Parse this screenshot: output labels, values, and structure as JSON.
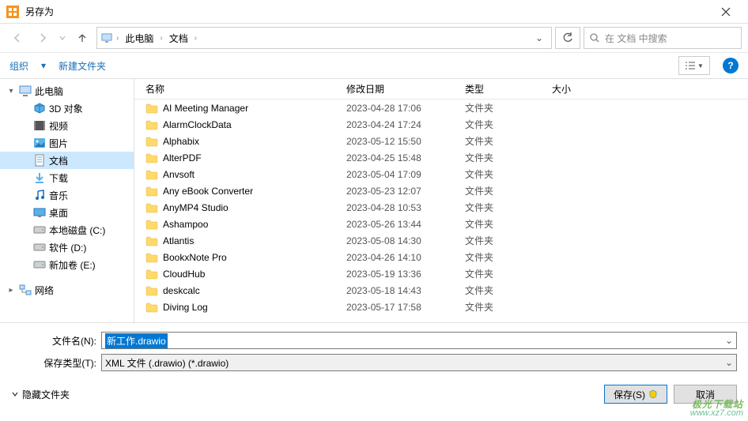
{
  "window": {
    "title": "另存为"
  },
  "breadcrumb": {
    "root": "此电脑",
    "folder": "文档"
  },
  "search": {
    "placeholder": "在 文档 中搜索"
  },
  "toolbar": {
    "organize": "组织",
    "newfolder": "新建文件夹"
  },
  "sidebar": [
    {
      "label": "此电脑",
      "icon": "pc",
      "exp": "▾",
      "level": 0
    },
    {
      "label": "3D 对象",
      "icon": "3d",
      "level": 1
    },
    {
      "label": "视频",
      "icon": "video",
      "level": 1
    },
    {
      "label": "图片",
      "icon": "pic",
      "level": 1
    },
    {
      "label": "文档",
      "icon": "doc",
      "level": 1,
      "selected": true
    },
    {
      "label": "下载",
      "icon": "dl",
      "level": 1
    },
    {
      "label": "音乐",
      "icon": "music",
      "level": 1
    },
    {
      "label": "桌面",
      "icon": "desk",
      "level": 1
    },
    {
      "label": "本地磁盘 (C:)",
      "icon": "disk",
      "level": 1
    },
    {
      "label": "软件 (D:)",
      "icon": "disk",
      "level": 1
    },
    {
      "label": "新加卷 (E:)",
      "icon": "disk",
      "level": 1
    },
    {
      "label": "网络",
      "icon": "net",
      "exp": "▸",
      "level": 0,
      "gap": true
    }
  ],
  "columns": {
    "name": "名称",
    "date": "修改日期",
    "type": "类型",
    "size": "大小"
  },
  "files": [
    {
      "name": "AI Meeting Manager",
      "date": "2023-04-28 17:06",
      "type": "文件夹"
    },
    {
      "name": "AlarmClockData",
      "date": "2023-04-24 17:24",
      "type": "文件夹"
    },
    {
      "name": "Alphabix",
      "date": "2023-05-12 15:50",
      "type": "文件夹"
    },
    {
      "name": "AlterPDF",
      "date": "2023-04-25 15:48",
      "type": "文件夹"
    },
    {
      "name": "Anvsoft",
      "date": "2023-05-04 17:09",
      "type": "文件夹"
    },
    {
      "name": "Any eBook Converter",
      "date": "2023-05-23 12:07",
      "type": "文件夹"
    },
    {
      "name": "AnyMP4 Studio",
      "date": "2023-04-28 10:53",
      "type": "文件夹"
    },
    {
      "name": "Ashampoo",
      "date": "2023-05-26 13:44",
      "type": "文件夹"
    },
    {
      "name": "Atlantis",
      "date": "2023-05-08 14:30",
      "type": "文件夹"
    },
    {
      "name": "BookxNote Pro",
      "date": "2023-04-26 14:10",
      "type": "文件夹"
    },
    {
      "name": "CloudHub",
      "date": "2023-05-19 13:36",
      "type": "文件夹"
    },
    {
      "name": "deskcalc",
      "date": "2023-05-18 14:43",
      "type": "文件夹"
    },
    {
      "name": "Diving Log",
      "date": "2023-05-17 17:58",
      "type": "文件夹"
    }
  ],
  "fields": {
    "filename_label": "文件名(N):",
    "filename_value": "新工作.drawio",
    "filetype_label": "保存类型(T):",
    "filetype_value": "XML 文件 (.drawio) (*.drawio)"
  },
  "footer": {
    "hide": "隐藏文件夹",
    "save": "保存(S)",
    "cancel": "取消"
  },
  "watermark": {
    "line1": "极光下载站",
    "line2": "www.xz7.com"
  }
}
